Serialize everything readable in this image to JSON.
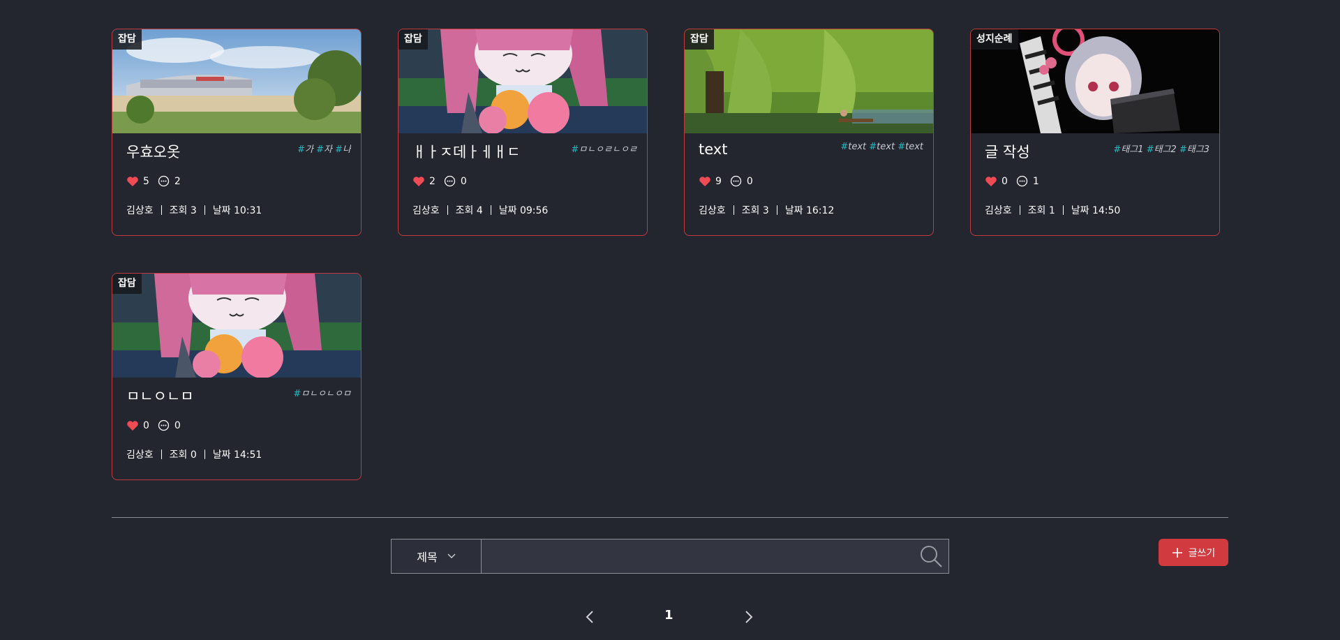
{
  "cards": [
    {
      "category": "잡담",
      "title": "우효오옷",
      "tags": [
        "가",
        "자",
        "나"
      ],
      "likes": "5",
      "comments": "2",
      "author": "김상호",
      "views": "조회 3",
      "date": "날짜 10:31",
      "thumb": "stadium"
    },
    {
      "category": "잡담",
      "title": "ㅐㅏㅈ데ㅏㅔㅐㄷ",
      "tags": [
        "ㅁㄴㅇㄹㄴㅇㄹ"
      ],
      "likes": "2",
      "comments": "0",
      "author": "김상호",
      "views": "조회 4",
      "date": "날짜 09:56",
      "thumb": "anime-girl-flowers"
    },
    {
      "category": "잡담",
      "title": "text",
      "tags": [
        "text",
        "text",
        "text"
      ],
      "likes": "9",
      "comments": "0",
      "author": "김상호",
      "views": "조회 3",
      "date": "날짜 16:12",
      "thumb": "park-willow"
    },
    {
      "category": "성지순례",
      "title": "글 작성",
      "tags": [
        "태그1",
        "태그2",
        "태그3"
      ],
      "likes": "0",
      "comments": "1",
      "author": "김상호",
      "views": "조회 1",
      "date": "날짜 14:50",
      "thumb": "anime-girl-laptop"
    },
    {
      "category": "잡담",
      "title": "ㅁㄴㅇㄴㅁ",
      "tags": [
        "ㅁㄴㅇㄴㅇㅁ"
      ],
      "likes": "0",
      "comments": "0",
      "author": "김상호",
      "views": "조회 0",
      "date": "날짜 14:51",
      "thumb": "anime-girl-flowers"
    }
  ],
  "search": {
    "select_label": "제목",
    "placeholder": "",
    "value": "",
    "icon": "search-icon"
  },
  "write_button": {
    "label": "글쓰기",
    "icon": "plus-icon"
  },
  "pagination": {
    "current": "1",
    "prev_icon": "chevron-left-icon",
    "next_icon": "chevron-right-icon"
  },
  "colors": {
    "accent": "#d13a3e",
    "tag": "#25b8c0",
    "card_border": "#c03c3c",
    "background": "#23252f"
  }
}
